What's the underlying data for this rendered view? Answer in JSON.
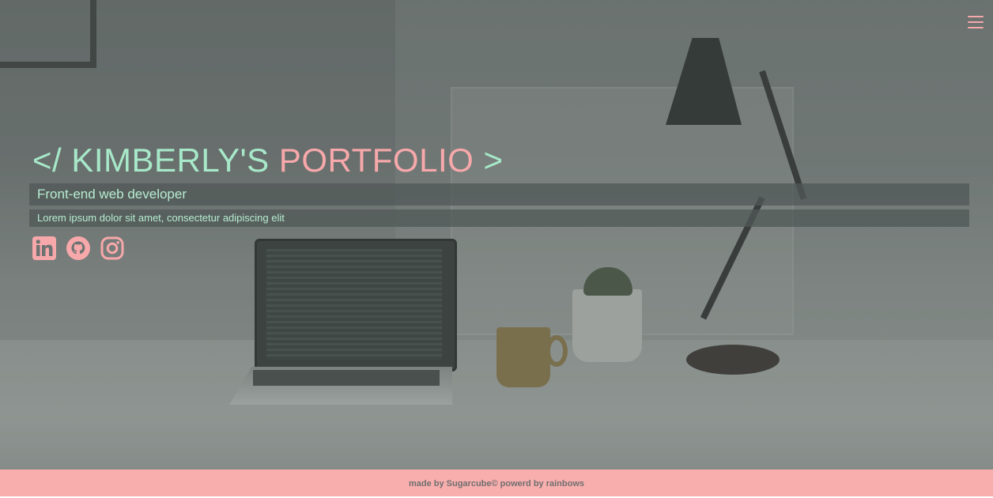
{
  "header": {
    "menu_icon": "hamburger-menu-icon"
  },
  "hero": {
    "title_part1": "</ KIMBERLY'S",
    "title_part2": "PORTFOLIO",
    "title_part3": ">",
    "role": "Front-end web developer",
    "tagline": "Lorem ipsum dolor sit amet, consectetur adipiscing elit"
  },
  "social": [
    {
      "icon": "linkedin-icon"
    },
    {
      "icon": "github-icon"
    },
    {
      "icon": "instagram-icon"
    }
  ],
  "footer": {
    "text": "made by Sugarcube© powerd by rainbows"
  },
  "colors": {
    "mint": "#a7e8c9",
    "pink": "#f7a8aa",
    "footer_bg": "#f9aeae"
  }
}
